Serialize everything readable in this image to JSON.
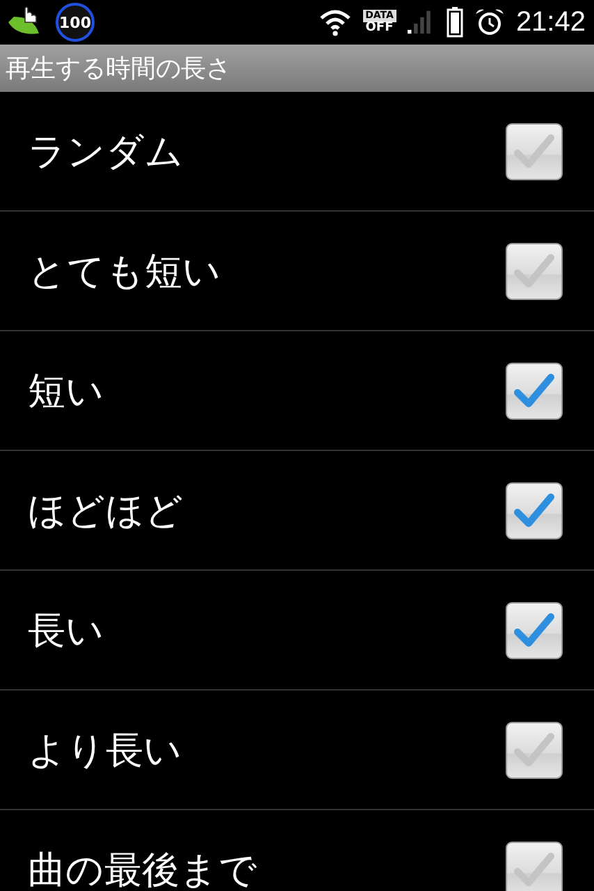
{
  "status_bar": {
    "badge": "100",
    "data_label": "DATA",
    "data_state": "OFF",
    "time": "21:42"
  },
  "title": "再生する時間の長さ",
  "options": [
    {
      "label": "ランダム",
      "checked": false
    },
    {
      "label": "とても短い",
      "checked": false
    },
    {
      "label": "短い",
      "checked": true
    },
    {
      "label": "ほどほど",
      "checked": true
    },
    {
      "label": "長い",
      "checked": true
    },
    {
      "label": "より長い",
      "checked": false
    },
    {
      "label": "曲の最後まで",
      "checked": false
    }
  ]
}
